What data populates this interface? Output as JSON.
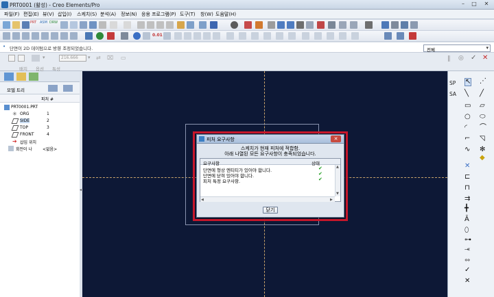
{
  "window": {
    "title": "PRT0001 (활성) - Creo Elements/Pro",
    "minimize": "–",
    "maximize": "□",
    "close": "✕"
  },
  "menu": [
    "파일(F)",
    "편집(E)",
    "뷰(V)",
    "삽입(I)",
    "스케치(S)",
    "분석(A)",
    "정보(N)",
    "응용 프로그램(P)",
    "도구(T)",
    "창(W)",
    "도움말(H)"
  ],
  "toolbar": {
    "prt_label": "PRT",
    "asm_label": "ASM",
    "drw_label": "DRW",
    "sketch_dim_label": "0.01"
  },
  "message_area": {
    "text": "단면이 2D 데이텀으로 방향 조정되었습니다."
  },
  "filter": {
    "value": "전체"
  },
  "dashboard": {
    "depth_value": "216.666",
    "tabs": [
      "배치",
      "옵션",
      "특성"
    ]
  },
  "model_tree": {
    "title": "모델 트리",
    "column_header": "피처 #",
    "root": "PRT0001.PRT",
    "items": [
      {
        "name": "ORG",
        "feature_no": "1"
      },
      {
        "name": "SIDE",
        "feature_no": "2"
      },
      {
        "name": "TOP",
        "feature_no": "3"
      },
      {
        "name": "FRONT",
        "feature_no": "4"
      },
      {
        "name": "삽입 위치",
        "feature_no": ""
      },
      {
        "name": "회전이 나",
        "feature_no": "<없음>"
      }
    ]
  },
  "right_toolbar": {
    "sp_label": "SP",
    "sa_label": "SA"
  },
  "dialog": {
    "title": "피처 요구사항",
    "message_line1": "스케치가 현재 피처에 적합함.",
    "message_line2": "아래 나열된 모든 요구사항이 충족되었습니다.",
    "col_requirement": "요구사항",
    "col_status": "상태",
    "requirements": [
      {
        "text": "단면에 형상 엔티티가 있어야 합니다.",
        "status": "✔"
      },
      {
        "text": "단면에 닫혀 있어야 합니다.",
        "status": "✔"
      },
      {
        "text": "피처 특정 요구사항.",
        "status": "✔"
      }
    ],
    "close_button": "닫기",
    "accent_border": "#c8172b",
    "status_color": "#1a9a1a"
  }
}
